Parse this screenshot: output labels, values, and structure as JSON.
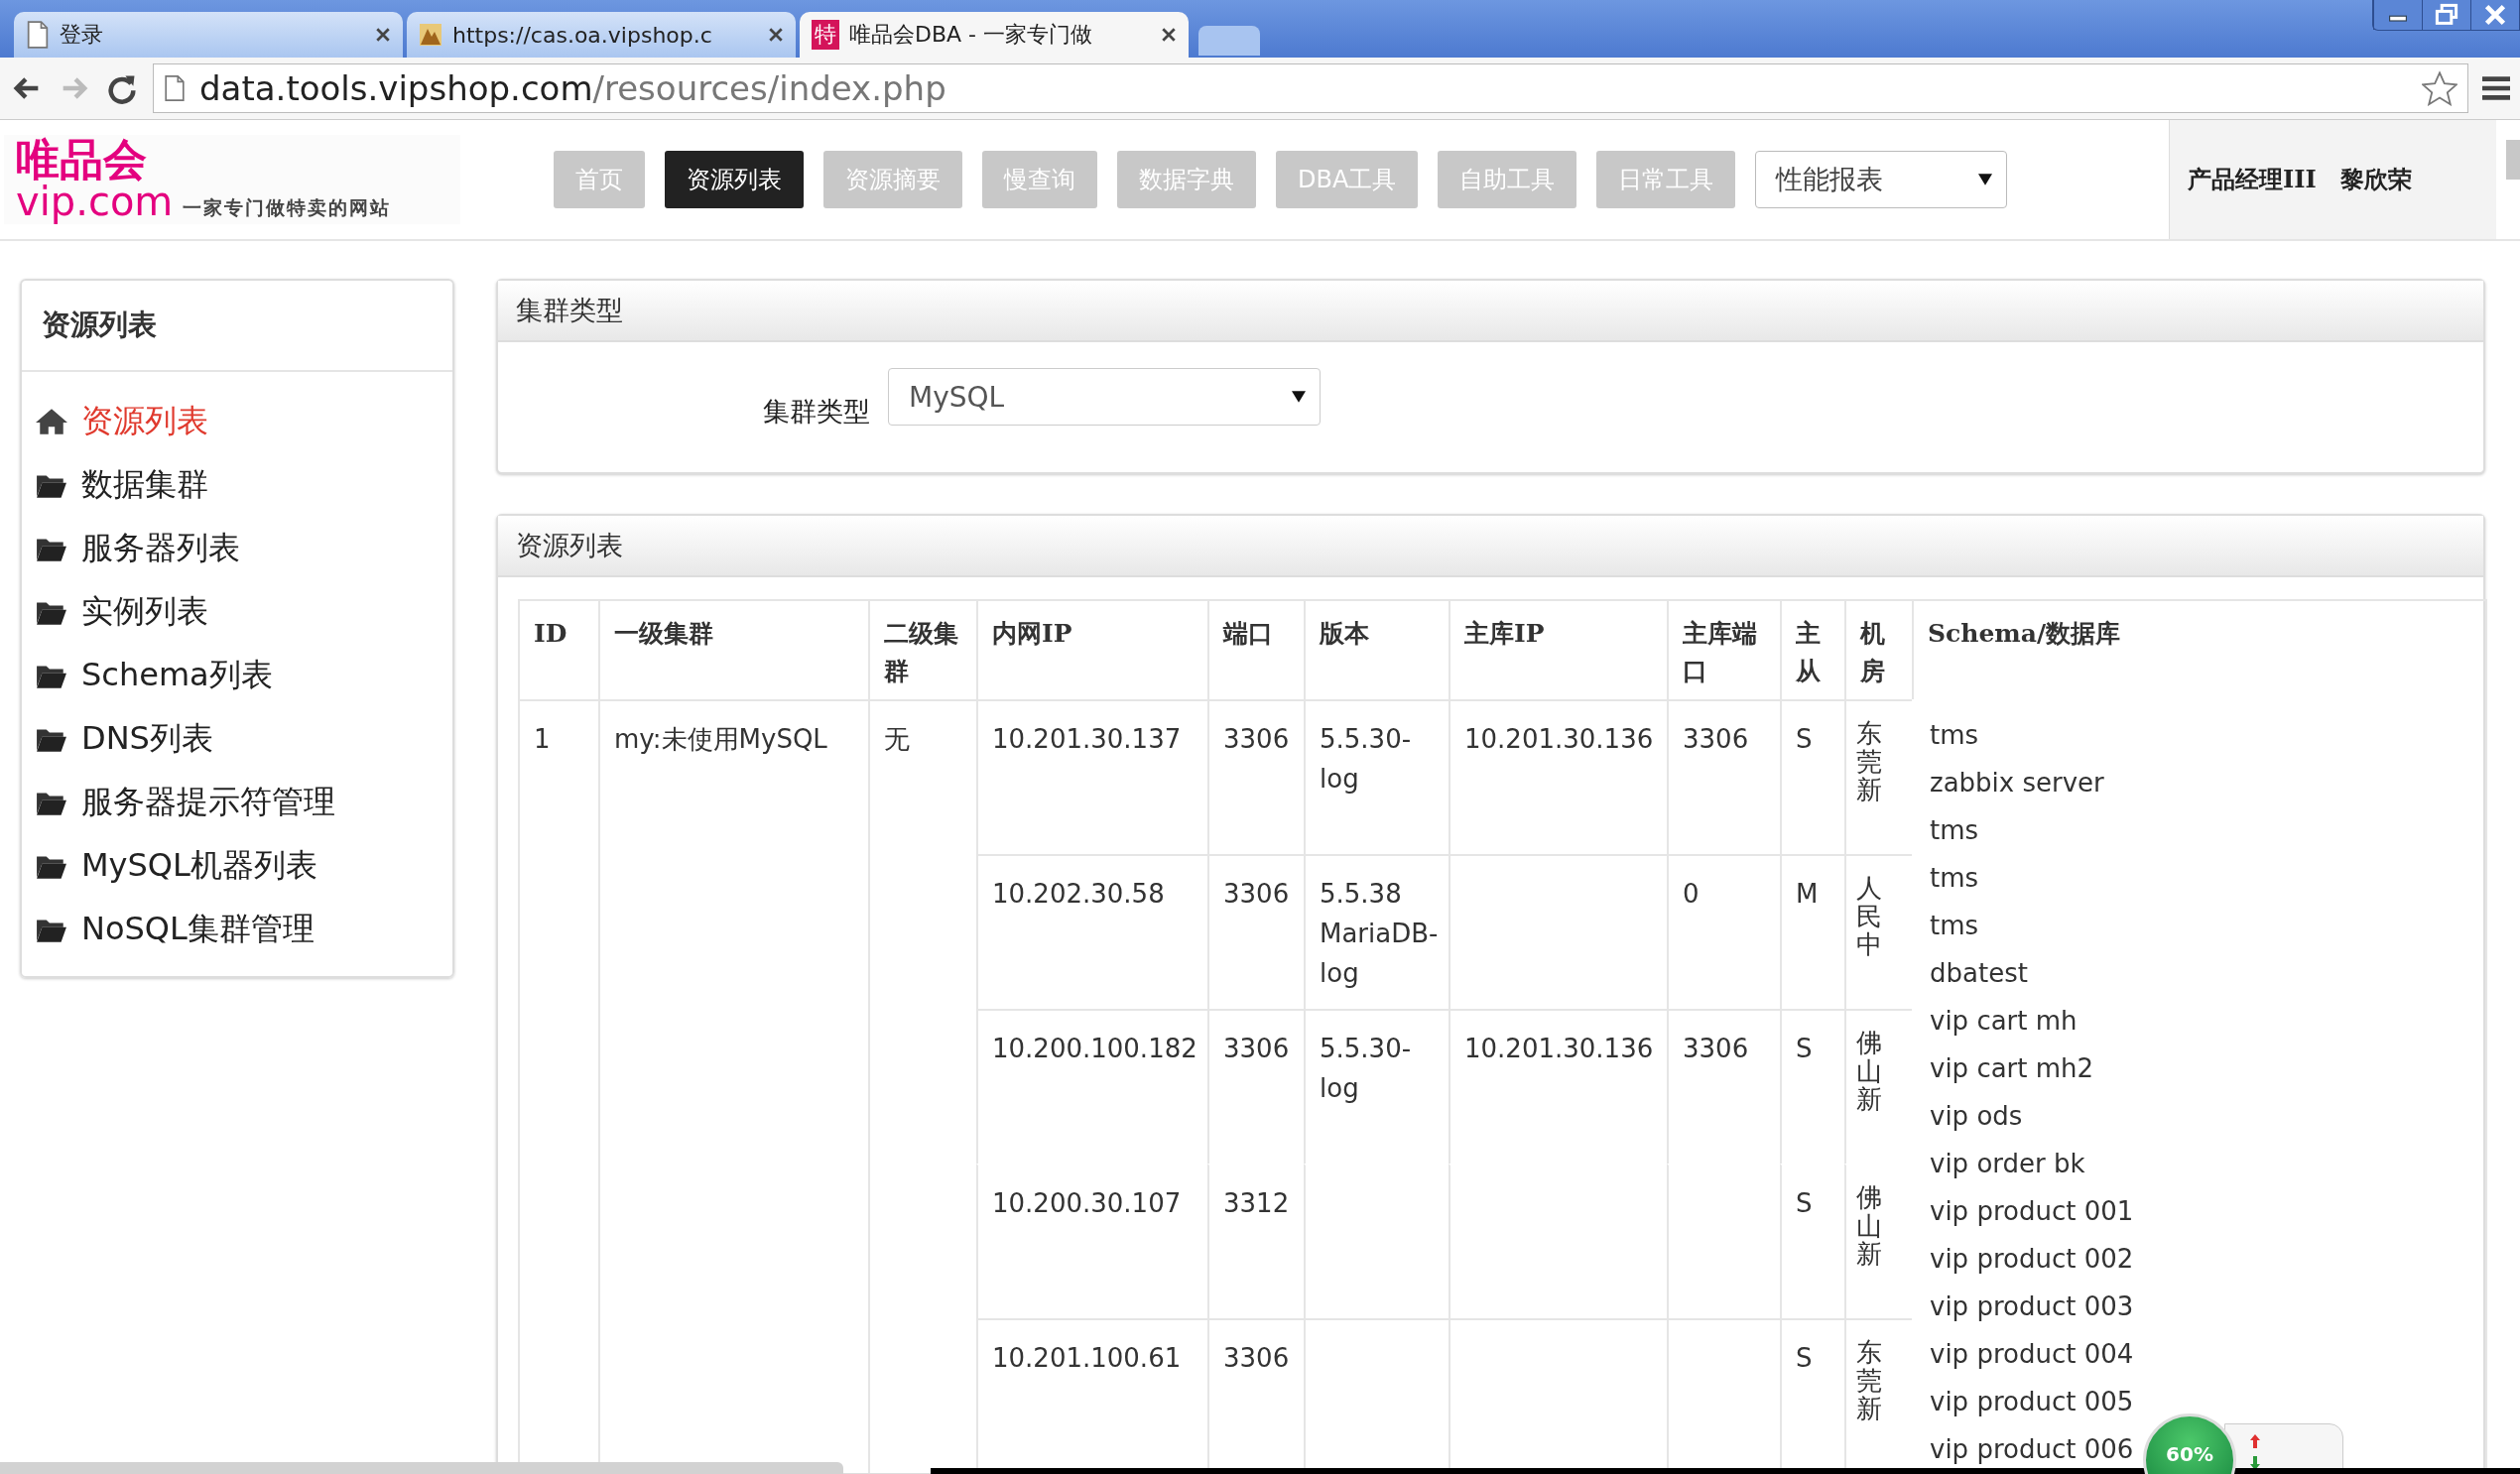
{
  "browser": {
    "tabs": [
      {
        "title": "登录",
        "selected": false,
        "kind": "page"
      },
      {
        "title": "https://cas.oa.vipshop.c",
        "selected": false,
        "kind": "image"
      },
      {
        "title": "唯品会DBA - 一家专门做",
        "selected": true,
        "kind": "badge",
        "badge_text": "特"
      }
    ],
    "url_host": "data.tools.vipshop.com",
    "url_path": "/resources/index.php"
  },
  "header": {
    "logo_cn": "唯品会",
    "logo_en": "vip.com",
    "slogan": "一家专门做特卖的网站",
    "nav": [
      {
        "label": "首页",
        "selected": false
      },
      {
        "label": "资源列表",
        "selected": true
      },
      {
        "label": "资源摘要",
        "selected": false
      },
      {
        "label": "慢查询",
        "selected": false
      },
      {
        "label": "数据字典",
        "selected": false
      },
      {
        "label": "DBA工具",
        "selected": false
      },
      {
        "label": "自助工具",
        "selected": false
      },
      {
        "label": "日常工具",
        "selected": false
      }
    ],
    "nav_dropdown": "性能报表",
    "user_role": "产品经理III",
    "user_name": "黎欣荣"
  },
  "sidebar": {
    "title": "资源列表",
    "items": [
      {
        "label": "资源列表",
        "selected": true,
        "kind": "home"
      },
      {
        "label": "数据集群",
        "selected": false,
        "kind": "folder"
      },
      {
        "label": "服务器列表",
        "selected": false,
        "kind": "folder"
      },
      {
        "label": "实例列表",
        "selected": false,
        "kind": "folder"
      },
      {
        "label": "Schema列表",
        "selected": false,
        "kind": "folder"
      },
      {
        "label": "DNS列表",
        "selected": false,
        "kind": "folder"
      },
      {
        "label": "服务器提示符管理",
        "selected": false,
        "kind": "folder"
      },
      {
        "label": "MySQL机器列表",
        "selected": false,
        "kind": "folder"
      },
      {
        "label": "NoSQL集群管理",
        "selected": false,
        "kind": "folder"
      }
    ]
  },
  "filter_panel": {
    "title": "集群类型",
    "label": "集群类型",
    "value": "MySQL"
  },
  "resource_panel": {
    "title": "资源列表",
    "columns": [
      "ID",
      "一级集群",
      "二级集群",
      "内网IP",
      "端口",
      "版本",
      "主库IP",
      "主库端口",
      "主从",
      "机房",
      "Schema/数据库"
    ],
    "cluster": {
      "id": "1",
      "level1": "my:未使用MySQL",
      "level2": "无",
      "instances": [
        {
          "ip": "10.201.30.137",
          "port": "3306",
          "version": "5.5.30-log",
          "master_ip": "10.201.30.136",
          "master_port": "3306",
          "role": "S",
          "idc": "东莞新",
          "continued": false
        },
        {
          "ip": "10.202.30.58",
          "port": "3306",
          "version": "5.5.38 MariaDB-log",
          "master_port": "0",
          "role": "M",
          "idc": "人民中",
          "continued": false
        },
        {
          "ip": "10.200.100.182",
          "port": "3306",
          "version": "5.5.30-log",
          "master_ip": "10.201.30.136",
          "master_port": "3306",
          "role": "S",
          "idc": "佛山新",
          "continued": false
        },
        {
          "ip": "10.200.30.107",
          "port": "3312",
          "role": "S",
          "idc": "佛山新",
          "continued": true
        },
        {
          "ip": "10.201.100.61",
          "port": "3306",
          "role": "S",
          "idc": "东莞新",
          "continued": false
        }
      ],
      "schemas": [
        "tms",
        "zabbix server",
        "tms",
        "tms",
        "tms",
        "dbatest",
        "vip cart mh",
        "vip cart mh2",
        "vip ods",
        "vip order bk",
        "vip product 001",
        "vip product 002",
        "vip product 003",
        "vip product 004",
        "vip product 005",
        "vip product 006"
      ]
    }
  },
  "overlay": {
    "percent": "60%"
  }
}
